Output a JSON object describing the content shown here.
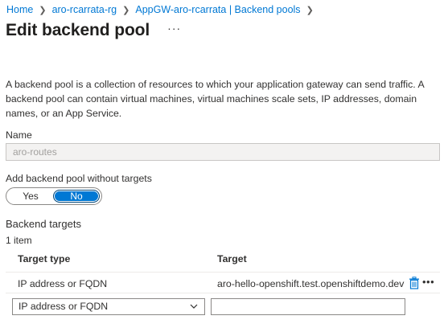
{
  "breadcrumb": [
    {
      "label": "Home"
    },
    {
      "label": "aro-rcarrata-rg"
    },
    {
      "label": "AppGW-aro-rcarrata | Backend pools"
    }
  ],
  "page": {
    "title": "Edit backend pool",
    "more_icon": "ellipsis-icon",
    "description": "A backend pool is a collection of resources to which your application gateway can send traffic. A backend pool can contain virtual machines, virtual machines scale sets, IP addresses, domain names, or an App Service."
  },
  "name_field": {
    "label": "Name",
    "value": "aro-routes"
  },
  "without_targets": {
    "label": "Add backend pool without targets",
    "options": [
      "Yes",
      "No"
    ],
    "selected": "No"
  },
  "backend_targets": {
    "title": "Backend targets",
    "count": "1 item",
    "columns": [
      "Target type",
      "Target"
    ],
    "rows": [
      {
        "type": "IP address or FQDN",
        "target": "aro-hello-openshift.test.openshiftdemo.dev"
      }
    ],
    "new_row": {
      "type": "IP address or FQDN",
      "target": ""
    }
  },
  "colors": {
    "accent": "#0078d4",
    "link": "#0078d4",
    "text": "#323130"
  }
}
